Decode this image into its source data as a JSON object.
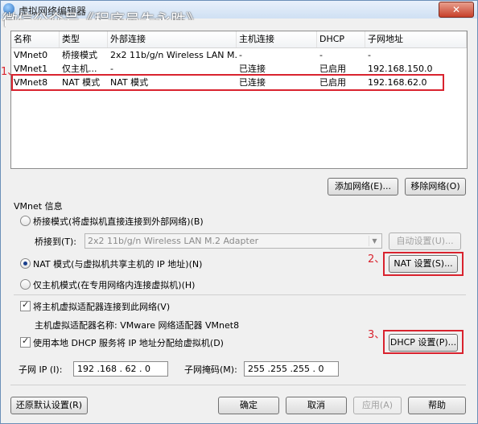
{
  "window": {
    "title": "虚拟网络编辑器",
    "watermark": "微信公众号《程序员朱永胜》",
    "close_glyph": "✕"
  },
  "table": {
    "headers": [
      "名称",
      "类型",
      "外部连接",
      "主机连接",
      "DHCP",
      "子网地址"
    ],
    "rows": [
      {
        "name": "VMnet0",
        "type": "桥接模式",
        "external": "2x2 11b/g/n Wireless LAN M...",
        "host": "-",
        "dhcp": "-",
        "subnet": "-"
      },
      {
        "name": "VMnet1",
        "type": "仅主机...",
        "external": "-",
        "host": "已连接",
        "dhcp": "已启用",
        "subnet": "192.168.150.0"
      },
      {
        "name": "VMnet8",
        "type": "NAT 模式",
        "external": "NAT 模式",
        "host": "已连接",
        "dhcp": "已启用",
        "subnet": "192.168.62.0"
      }
    ]
  },
  "annotations": {
    "one": "1、",
    "two": "2、",
    "three": "3、"
  },
  "buttons": {
    "add_network": "添加网络(E)...",
    "remove_network": "移除网络(O)",
    "auto_settings": "自动设置(U)...",
    "nat_settings": "NAT 设置(S)...",
    "dhcp_settings": "DHCP 设置(P)...",
    "restore_defaults": "还原默认设置(R)",
    "ok": "确定",
    "cancel": "取消",
    "apply": "应用(A)",
    "help": "帮助"
  },
  "vmnet_info": {
    "group_title": "VMnet 信息",
    "bridge_mode": "桥接模式(将虚拟机直接连接到外部网络)(B)",
    "bridge_to_label": "桥接到(T):",
    "bridge_to_value": "2x2 11b/g/n Wireless LAN M.2 Adapter",
    "nat_mode": "NAT 模式(与虚拟机共享主机的 IP 地址)(N)",
    "host_only_mode": "仅主机模式(在专用网络内连接虚拟机)(H)",
    "connect_host_adapter": "将主机虚拟适配器连接到此网络(V)",
    "host_adapter_name": "主机虚拟适配器名称: VMware 网络适配器 VMnet8",
    "use_dhcp": "使用本地 DHCP 服务将 IP 地址分配给虚拟机(D)",
    "selected_mode": "nat",
    "connect_host_adapter_checked": true,
    "use_dhcp_checked": true
  },
  "subnet": {
    "ip_label": "子网 IP (I):",
    "ip_value": "192 .168 . 62 . 0",
    "mask_label": "子网掩码(M):",
    "mask_value": "255 .255 .255 . 0"
  },
  "colors": {
    "highlight_red": "#d9232e"
  }
}
